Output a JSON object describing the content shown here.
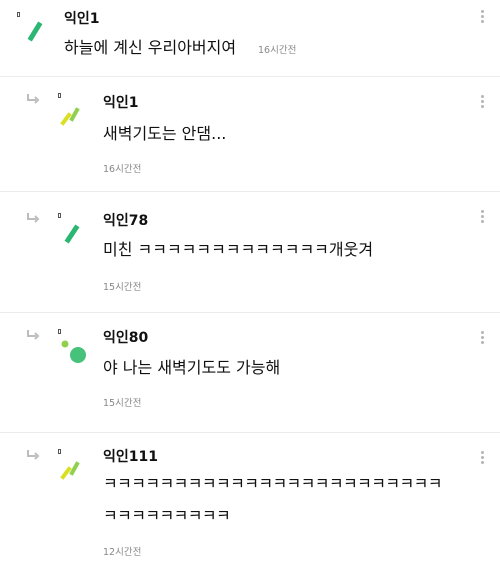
{
  "comments": [
    {
      "author": "익인1",
      "text": "하늘에 계신 우리아버지여",
      "time": "16시간전",
      "is_reply": false
    },
    {
      "author": "익인1",
      "text": "새벽기도는 안댐...",
      "time": "16시간전",
      "is_reply": true
    },
    {
      "author": "익인78",
      "text": "미친 ㅋㅋㅋㅋㅋㅋㅋㅋㅋㅋㅋㅋㅋ개웃겨",
      "time": "15시간전",
      "is_reply": true
    },
    {
      "author": "익인80",
      "text": "야 나는 새벽기도도 가능해",
      "time": "15시간전",
      "is_reply": true
    },
    {
      "author": "익인111",
      "text_line1": "ㅋㅋㅋㅋㅋㅋㅋㅋㅋㅋㅋㅋㅋㅋㅋㅋㅋㅋㅋㅋㅋㅋㅋㅋ",
      "text_line2": "ㅋㅋㅋㅋㅋㅋㅋㅋㅋ",
      "time": "12시간전",
      "is_reply": true
    }
  ],
  "colors": {
    "avatar_green": "#2bb673",
    "avatar_light_green": "#8fd14f",
    "avatar_yellow": "#d9e021",
    "separator": "#ececec"
  }
}
